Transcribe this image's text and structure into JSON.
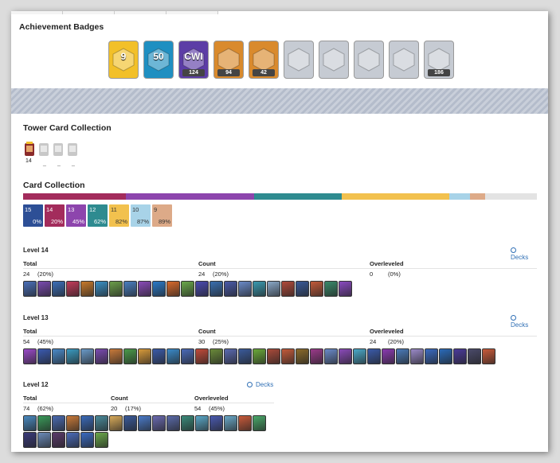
{
  "achievement": {
    "title": "Achievement Badges",
    "badges": [
      {
        "name": "classic-9-badge",
        "bg": "#f2c029",
        "overlay": "9",
        "count": ""
      },
      {
        "name": "years-played-badge",
        "bg": "#1f8fc1",
        "overlay": "50",
        "count": ""
      },
      {
        "name": "cw1-badge",
        "bg": "#5c3da6",
        "overlay": "CWI",
        "count": "124"
      },
      {
        "name": "cards-collected-badge",
        "bg": "#d98a2d",
        "overlay": "",
        "count": "94"
      },
      {
        "name": "crown-badge",
        "bg": "#d98a2d",
        "overlay": "",
        "count": "42"
      },
      {
        "name": "mastery-1-badge",
        "bg": "#c6cbd3",
        "overlay": "",
        "count": ""
      },
      {
        "name": "mastery-2-badge",
        "bg": "#c6cbd3",
        "overlay": "",
        "count": ""
      },
      {
        "name": "mastery-3-badge",
        "bg": "#c6cbd3",
        "overlay": "",
        "count": ""
      },
      {
        "name": "mastery-4-badge",
        "bg": "#c6cbd3",
        "overlay": "",
        "count": ""
      },
      {
        "name": "emote-collection-badge",
        "bg": "#c6cbd3",
        "overlay": "",
        "count": "186"
      }
    ]
  },
  "tower": {
    "title": "Tower Card Collection",
    "level": "14",
    "dashes": [
      "_",
      "_",
      "_"
    ]
  },
  "collection": {
    "title": "Card Collection",
    "bar": [
      {
        "color": "#a32c5c",
        "pct": 20
      },
      {
        "color": "#8d45ad",
        "pct": 25
      },
      {
        "color": "#2e8b90",
        "pct": 17
      },
      {
        "color": "#f2c14e",
        "pct": 21
      },
      {
        "color": "#a8d3e8",
        "pct": 4
      },
      {
        "color": "#ddaa88",
        "pct": 3
      },
      {
        "color": "#e3e3e3",
        "pct": 10
      }
    ],
    "levels": [
      {
        "level": "15",
        "pct": "0%",
        "color": "#2d4f96"
      },
      {
        "level": "14",
        "pct": "20%",
        "color": "#a32c5c"
      },
      {
        "level": "13",
        "pct": "45%",
        "color": "#8d45ad"
      },
      {
        "level": "12",
        "pct": "62%",
        "color": "#2e8b90"
      },
      {
        "level": "11",
        "pct": "82%",
        "color": "#f2c14e"
      },
      {
        "level": "10",
        "pct": "87%",
        "color": "#a8d3e8"
      },
      {
        "level": "9",
        "pct": "89%",
        "color": "#ddaa88"
      }
    ]
  },
  "sections": [
    {
      "title": "Level 14",
      "decks": "Decks",
      "headers": [
        "Total",
        "Count",
        "Overleveled"
      ],
      "values": [
        {
          "n": "24",
          "p": "(20%)"
        },
        {
          "n": "24",
          "p": "(20%)"
        },
        {
          "n": "0",
          "p": "(0%)"
        }
      ],
      "card_colors": [
        "#4a6fb8",
        "#7a4ab0",
        "#3c6fb8",
        "#c23b5a",
        "#c77a2c",
        "#3a8fc4",
        "#6b9e4a",
        "#4a7fc0",
        "#8a4ab8",
        "#2a7ac8",
        "#d86a2c",
        "#6aa84a",
        "#4a4ab0",
        "#3a6fb0",
        "#4a5aa8",
        "#6a8ac8",
        "#3a9ab0",
        "#8aa8c8",
        "#b04a3a",
        "#3a5a98",
        "#c25a3a",
        "#3a8a6a",
        "#8a4ac0"
      ]
    },
    {
      "title": "Level 13",
      "decks": "Decks",
      "headers": [
        "Total",
        "Count",
        "Overleveled"
      ],
      "values": [
        {
          "n": "54",
          "p": "(45%)"
        },
        {
          "n": "30",
          "p": "(25%)"
        },
        {
          "n": "24",
          "p": "(20%)"
        }
      ],
      "card_colors": [
        "#9a4ac8",
        "#3a5ab0",
        "#4a8ac8",
        "#3a9ac0",
        "#6a9ac8",
        "#7a4ab0",
        "#c87a3a",
        "#4a9a4a",
        "#d89a3a",
        "#3a5aa8",
        "#3a8ac8",
        "#4a6ab8",
        "#c04a3a",
        "#6a8a3a",
        "#5a6ab0",
        "#3a5a9a",
        "#6aa83a",
        "#a84a3a",
        "#c25a3a",
        "#8a6a2a",
        "#9a3a8a",
        "#6a8ac8",
        "#8a4ab8",
        "#4aa8c8",
        "#3a5aa8",
        "#8a3ab0",
        "#4a7ab8",
        "#9a8ac8",
        "#3a6ac0",
        "#2a6ab8",
        "#4a3a9a",
        "#4a4a6a",
        "#c85a3a"
      ]
    },
    {
      "title": "Level 12",
      "decks": "Decks",
      "headers": [
        "Total",
        "Count",
        "Overleveled"
      ],
      "values": [
        {
          "n": "74",
          "p": "(62%)"
        },
        {
          "n": "20",
          "p": "(17%)"
        },
        {
          "n": "54",
          "p": "(45%)"
        }
      ],
      "card_colors": [
        "#4a8ac0",
        "#3a9a5a",
        "#4a6ab0",
        "#c87a3a",
        "#3a6ab8",
        "#4a8a9a",
        "#d8aa5a",
        "#3a5a9a",
        "#4a7ac8",
        "#6a6ab0",
        "#5a6aa8",
        "#3a8a7a",
        "#5aa8c8",
        "#4a5ab0",
        "#6aa8c8",
        "#c85a3a",
        "#4aa86a",
        "#3a3a7a",
        "#6a8ab8",
        "#5a3a6a",
        "#4a6ab8",
        "#3a6ac0",
        "#6aa84a"
      ]
    }
  ]
}
